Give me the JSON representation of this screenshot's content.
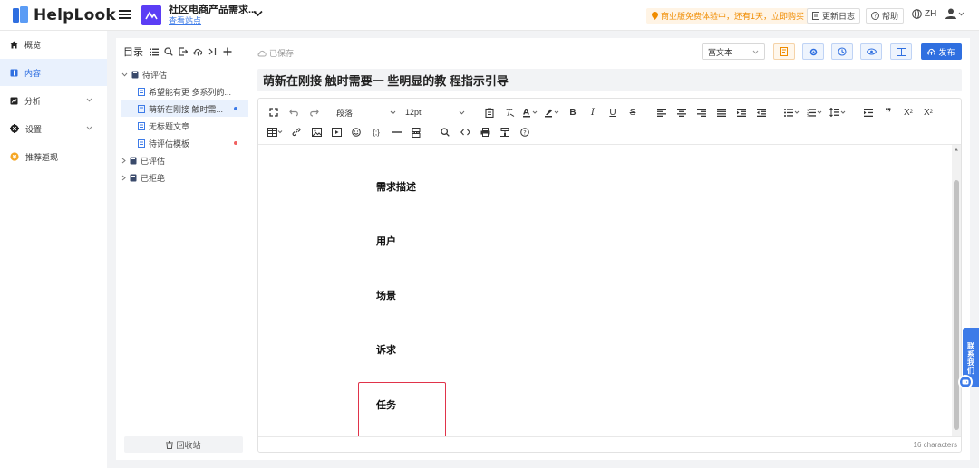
{
  "app": {
    "brand": "HelpLook",
    "space_name": "社区电商产品需求...",
    "space_link": "查看站点"
  },
  "header": {
    "promo": "商业版免费体验中，还有1天，立即购买",
    "changelog": "更新日志",
    "help": "帮助",
    "language": "ZH"
  },
  "nav": {
    "items": [
      {
        "label": "概览",
        "icon": "home-icon"
      },
      {
        "label": "内容",
        "icon": "book-icon"
      },
      {
        "label": "分析",
        "icon": "chart-icon"
      },
      {
        "label": "设置",
        "icon": "gear-icon"
      },
      {
        "label": "推荐返现",
        "icon": "coin-icon"
      }
    ]
  },
  "tree": {
    "title": "目录",
    "nodes": [
      {
        "label": "待评估",
        "type": "folder"
      },
      {
        "label": "希望能有更 多系列的...",
        "type": "doc"
      },
      {
        "label": "萌新在刚接 触时需...",
        "type": "doc"
      },
      {
        "label": "无标题文章",
        "type": "doc"
      },
      {
        "label": "待评估模板",
        "type": "doc"
      },
      {
        "label": "已评估",
        "type": "folder"
      },
      {
        "label": "已拒绝",
        "type": "folder"
      }
    ],
    "recycle_bin": "回收站"
  },
  "editor": {
    "saved_status": "已保存",
    "mode": "富文本",
    "publish": "发布",
    "title": "萌新在刚接 触时需要一 些明显的教 程指示引导",
    "paragraph_style": "段落",
    "font_size": "12pt",
    "headings": [
      "需求描述",
      "用户",
      "场景",
      "诉求",
      "任务"
    ],
    "char_count": "16 characters"
  },
  "contact": {
    "label": "联系我们"
  },
  "colors": {
    "accent": "#2f6fe0",
    "brand_purple": "#5b3df5",
    "promo_orange": "#f08c00",
    "highlight_red": "#e0334a"
  }
}
